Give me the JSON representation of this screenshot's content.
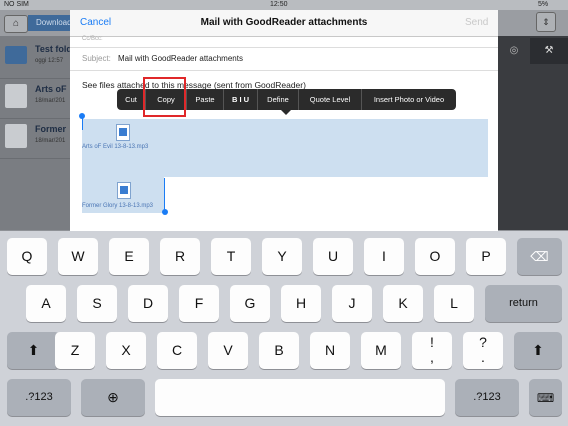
{
  "status": {
    "carrier": "NO SIM",
    "time": "12:50",
    "battery": "5%"
  },
  "background_app": {
    "breadcrumb": "Download",
    "rows": [
      {
        "title": "Test fold",
        "sub": "oggi 12:57"
      },
      {
        "title": "Arts oF",
        "sub": "18/mar/201"
      },
      {
        "title": "Former",
        "sub": "18/mar/201"
      }
    ]
  },
  "mail": {
    "cancel_label": "Cancel",
    "title": "Mail with GoodReader attachments",
    "send_label": "Send",
    "cc_label": "Cc/Bcc:",
    "subject_label": "Subject:",
    "subject_value": "Mail with GoodReader attachments",
    "body_text": "See files attached to this message (sent from GoodReader)",
    "attachments": [
      {
        "name": "Arts oF Evil 13-8-13.mp3"
      },
      {
        "name": "Former Glory 13-8-13.mp3"
      }
    ]
  },
  "edit_menu": {
    "items": [
      "Cut",
      "Copy",
      "Paste",
      "B I U",
      "Define",
      "Quote Level",
      "Insert Photo or Video"
    ]
  },
  "keyboard": {
    "row1": [
      "Q",
      "W",
      "E",
      "R",
      "T",
      "Y",
      "U",
      "I",
      "O",
      "P"
    ],
    "row2": [
      "A",
      "S",
      "D",
      "F",
      "G",
      "H",
      "J",
      "K",
      "L"
    ],
    "row3": [
      "Z",
      "X",
      "C",
      "V",
      "B",
      "N",
      "M",
      "!\n,",
      "?\n."
    ],
    "return_label": "return",
    "numbers_label": ".?123"
  },
  "colors": {
    "accent": "#1a7cf5",
    "selection": "#cddff0",
    "highlight_box": "#e0282a"
  }
}
